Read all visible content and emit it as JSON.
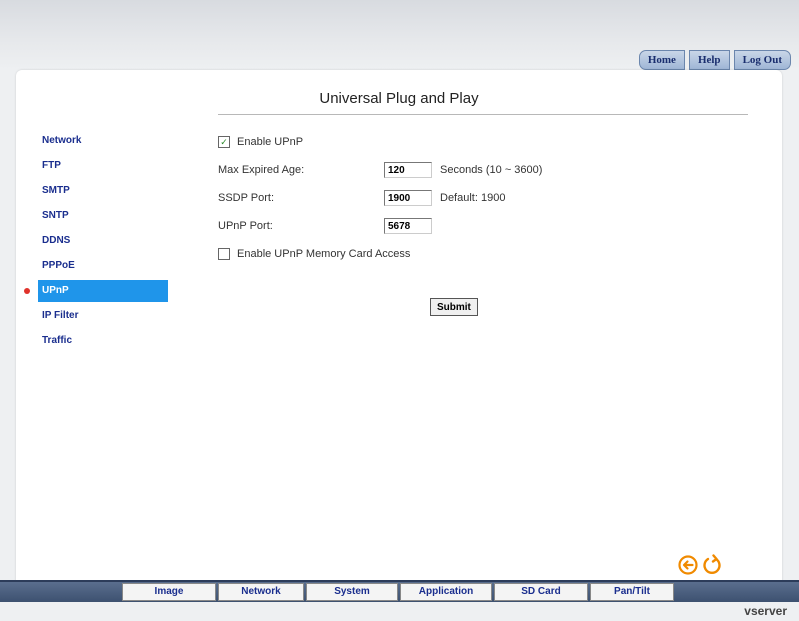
{
  "topnav": {
    "home": "Home",
    "help": "Help",
    "logout": "Log Out"
  },
  "page_title": "Universal Plug and Play",
  "sidebar": {
    "items": [
      {
        "label": "Network"
      },
      {
        "label": "FTP"
      },
      {
        "label": "SMTP"
      },
      {
        "label": "SNTP"
      },
      {
        "label": "DDNS"
      },
      {
        "label": "PPPoE"
      },
      {
        "label": "UPnP"
      },
      {
        "label": "IP Filter"
      },
      {
        "label": "Traffic"
      }
    ],
    "active": "UPnP"
  },
  "form": {
    "enable_upnp": {
      "label": "Enable UPnP",
      "checked": true
    },
    "max_expired_age": {
      "label": "Max Expired Age:",
      "value": "120",
      "hint": "Seconds (10 ~ 3600)"
    },
    "ssdp_port": {
      "label": "SSDP Port:",
      "value": "1900",
      "hint": "Default: 1900"
    },
    "upnp_port": {
      "label": "UPnP Port:",
      "value": "5678"
    },
    "enable_card_access": {
      "label": "Enable UPnP Memory Card Access",
      "checked": false
    },
    "submit_label": "Submit"
  },
  "bottom_tabs": [
    "Image",
    "Network",
    "System",
    "Application",
    "SD Card",
    "Pan/Tilt"
  ],
  "brand": "vserver",
  "icons": {
    "back": "back-arrow-icon",
    "refresh": "refresh-icon"
  },
  "colors": {
    "active_bg": "#1f95ea",
    "link": "#1a2e8e",
    "bullet": "#e0322b",
    "icon_orange": "#f08a00"
  }
}
